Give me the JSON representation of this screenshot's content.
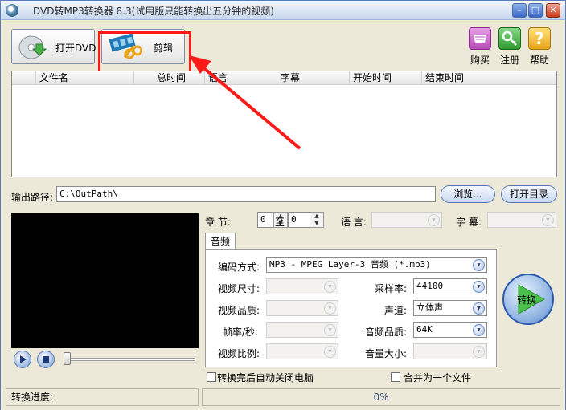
{
  "window": {
    "title": "DVD转MP3转换器 8.3(试用版只能转换出五分钟的视频)"
  },
  "toolbar": {
    "open_dvd_label": "打开DVD",
    "edit_label": "剪辑"
  },
  "side_buttons": {
    "buy_label": "购买",
    "register_label": "注册",
    "help_label": "帮助"
  },
  "file_list": {
    "columns": [
      "文件名",
      "总时间",
      "语言",
      "字幕",
      "开始时间",
      "结束时间"
    ]
  },
  "output": {
    "label": "输出路径:",
    "path": "C:\\OutPath\\",
    "browse_label": "浏览...",
    "open_dir_label": "打开目录"
  },
  "chapter": {
    "label": "章  节:",
    "from": "0",
    "to_label": "至",
    "to": "0",
    "language_label": "语  言:",
    "subtitle_label": "字  幕:"
  },
  "settings": {
    "tab_label": "音频",
    "codec_label": "编码方式:",
    "codec_value": "MP3 - MPEG Layer-3 音频 (*.mp3)",
    "video_size_label": "视频尺寸:",
    "video_quality_label": "视频品质:",
    "framerate_label": "帧率/秒:",
    "aspect_label": "视频比例:",
    "samplerate_label": "采样率:",
    "samplerate_value": "44100",
    "channel_label": "声道:",
    "channel_value": "立体声",
    "audio_quality_label": "音频品质:",
    "audio_quality_value": "64K",
    "volume_label": "音量大小:"
  },
  "convert_button_label": "转换",
  "options": {
    "auto_shutdown_label": "转换完后自动关闭电脑",
    "merge_label": "合并为一个文件"
  },
  "status": {
    "progress_label": "转换进度:",
    "progress_text": "0%",
    "progress_value": 0
  },
  "colors": {
    "highlight": "#ff1a1a",
    "annotation_arrow": "#ff1a1a",
    "accent": "#3a66c8"
  }
}
